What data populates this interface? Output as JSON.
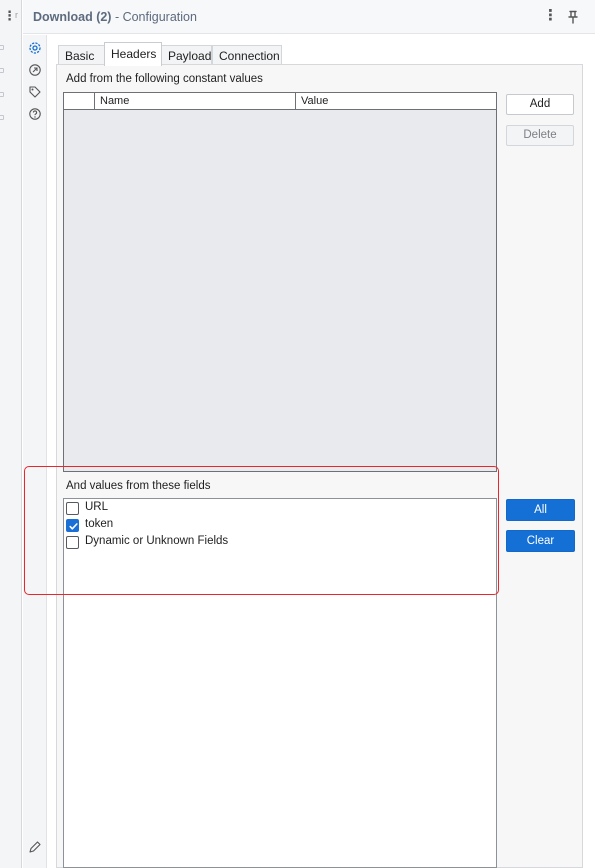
{
  "window": {
    "title_name": "Download (2)",
    "title_sep": " - ",
    "title_context": "Configuration",
    "left_fragment": "r"
  },
  "tabs": [
    {
      "label": "Basic",
      "active": false
    },
    {
      "label": "Headers",
      "active": true
    },
    {
      "label": "Payload",
      "active": false
    },
    {
      "label": "Connection",
      "active": false
    }
  ],
  "constants": {
    "section_label": "Add from the following constant values",
    "columns": [
      "",
      "Name",
      "Value"
    ],
    "add_label": "Add",
    "delete_label": "Delete"
  },
  "fields": {
    "section_label": "And values from these fields",
    "items": [
      {
        "label": "URL",
        "checked": false
      },
      {
        "label": "token",
        "checked": true
      },
      {
        "label": "Dynamic or Unknown Fields",
        "checked": false
      }
    ],
    "all_label": "All",
    "clear_label": "Clear"
  },
  "icons": {
    "sidebar": [
      "gear-icon",
      "connections-icon",
      "tag-icon",
      "help-icon"
    ],
    "header": [
      "more-icon",
      "pin-icon"
    ],
    "footer": [
      "pencil-icon"
    ]
  },
  "colors": {
    "primary": "#1570d6",
    "highlight": "#e8262d",
    "table_bg": "#e9eaed"
  }
}
